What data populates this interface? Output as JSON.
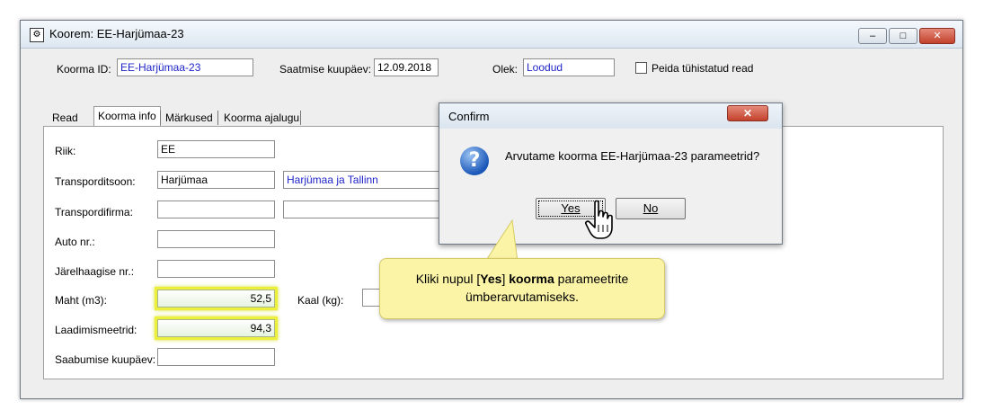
{
  "window": {
    "title": "Koorem: EE-Harjümaa-23",
    "caption_buttons": {
      "minimize": "–",
      "maximize": "□",
      "close": "✕"
    }
  },
  "header": {
    "koorma_id_label": "Koorma ID:",
    "koorma_id_value": "EE-Harjümaa-23",
    "saatmise_label": "Saatmise kuupäev:",
    "saatmise_value": "12.09.2018",
    "olek_label": "Olek:",
    "olek_value": "Loodud",
    "peida_label": "Peida tühistatud read"
  },
  "tabs": [
    "Read",
    "Koorma info",
    "Märkused",
    "Koorma ajalugu"
  ],
  "form": {
    "riik_label": "Riik:",
    "riik_value": "EE",
    "transporditsoon_label": "Transporditsoon:",
    "transporditsoon_value": "Harjümaa",
    "transporditsoon_desc": "Harjümaa ja Tallinn",
    "transpordifirma_label": "Transpordifirma:",
    "transpordifirma_value": "",
    "auto_label": "Auto nr.:",
    "auto_value": "",
    "jarelhaagise_label": "Järelhaagise nr.:",
    "jarelhaagise_value": "",
    "maht_label": "Maht (m3):",
    "maht_value": "52,5",
    "kaal_label": "Kaal (kg):",
    "kaal_value": "",
    "laadimis_label": "Laadimismeetrid:",
    "laadimis_value": "94,3",
    "saabumise_label": "Saabumise kuupäev:",
    "saabumise_value": ""
  },
  "dialog": {
    "title": "Confirm",
    "close_symbol": "✕",
    "icon_glyph": "?",
    "message": "Arvutame koorma EE-Harjümaa-23 parameetrid?",
    "yes_label": "Yes",
    "no_label": "No"
  },
  "callout": {
    "text_1": "Kliki nupul [",
    "bold_yes": "Yes",
    "text_2": "] ",
    "bold_koorma": "koorma",
    "text_3": " parameetrite ümberarvutamiseks."
  },
  "colors": {
    "highlight": "#ecf03c",
    "callout_bg": "#fbf4a7",
    "link_blue": "#1f25c9"
  }
}
